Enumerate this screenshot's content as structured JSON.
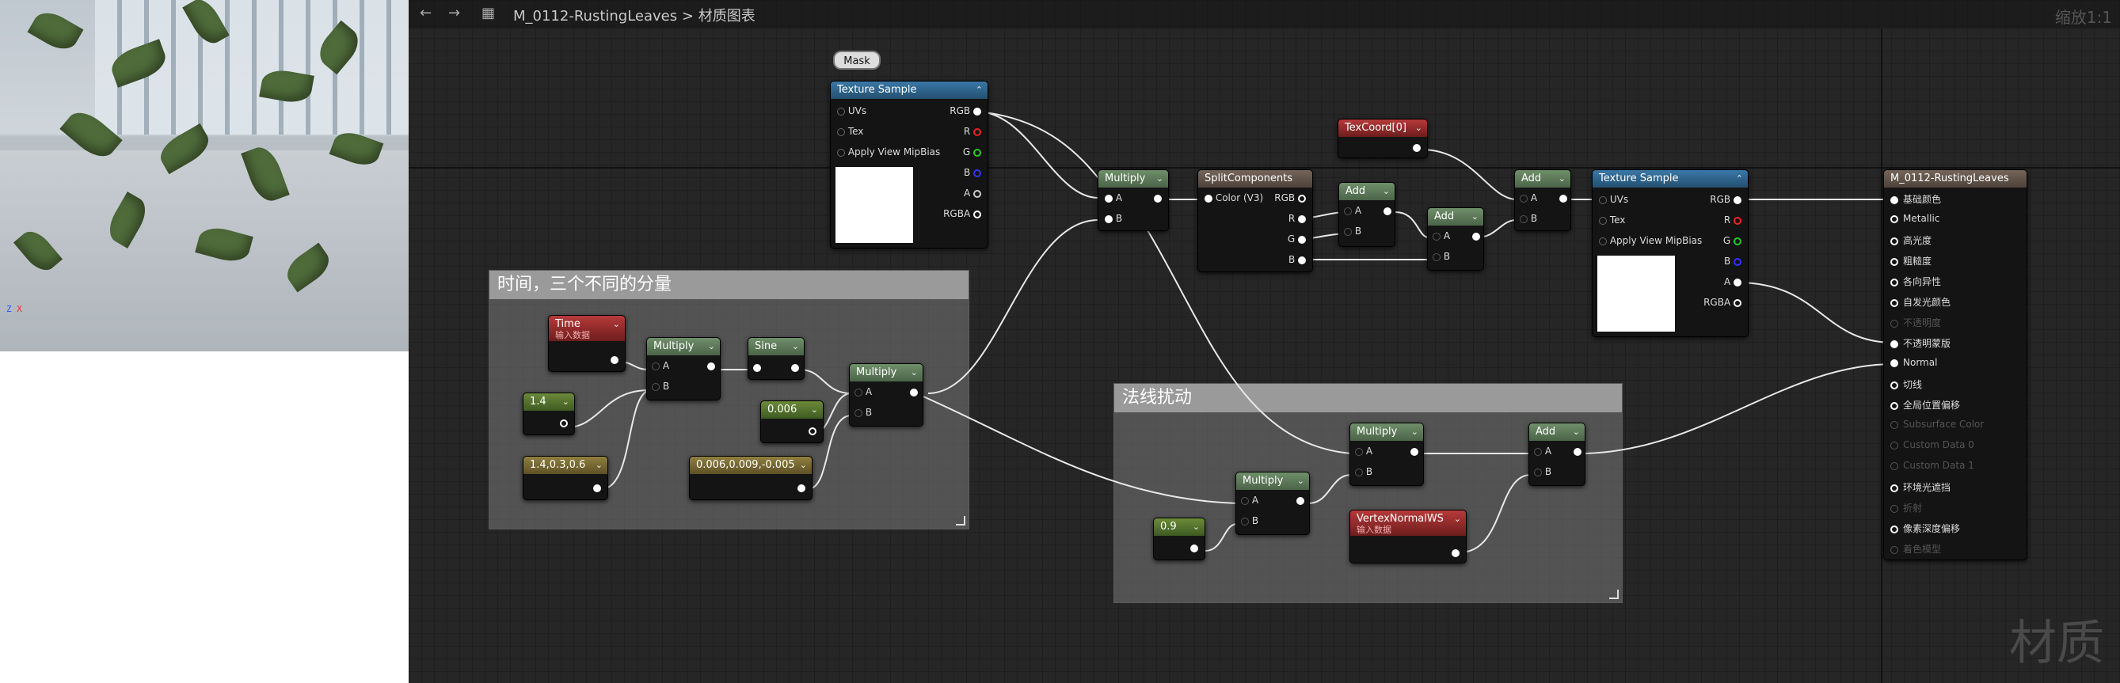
{
  "toolbar": {
    "back_icon": "arrow-left-icon",
    "forward_icon": "arrow-right-icon",
    "graph_icon": "graph-icon",
    "material_name": "M_0112-RustingLeaves",
    "separator": ">",
    "page": "材质图表",
    "zoom": "缩放1:1"
  },
  "preview": {
    "axis_z": "Z",
    "axis_x": "X"
  },
  "watermark": "材质",
  "comments": {
    "time": "时间，三个不同的分量",
    "normal": "法线扰动"
  },
  "nodes": {
    "mask": "Mask",
    "tex1": {
      "title": "Texture Sample",
      "pins_in": [
        "UVs",
        "Tex",
        "Apply View MipBias"
      ],
      "pins_out": [
        "RGB",
        "R",
        "G",
        "B",
        "A",
        "RGBA"
      ]
    },
    "multiply_top": {
      "title": "Multiply",
      "a": "A",
      "b": "B"
    },
    "split": {
      "title": "SplitComponents",
      "in": "Color (V3)",
      "rgb": "RGB",
      "r": "R",
      "g": "G",
      "b": "B"
    },
    "texcoord": {
      "title": "TexCoord[0]"
    },
    "add1": {
      "title": "Add",
      "a": "A",
      "b": "B"
    },
    "add2": {
      "title": "Add",
      "a": "A",
      "b": "B"
    },
    "add3": {
      "title": "Add",
      "a": "A",
      "b": "B"
    },
    "tex2": {
      "title": "Texture Sample",
      "pins_in": [
        "UVs",
        "Tex",
        "Apply View MipBias"
      ],
      "pins_out": [
        "RGB",
        "R",
        "G",
        "B",
        "A",
        "RGBA"
      ]
    },
    "time": {
      "title": "Time",
      "sub": "输入数据"
    },
    "const14": {
      "title": "1.4"
    },
    "const3": {
      "title": "1.4,0.3,0.6"
    },
    "multiply_t": {
      "title": "Multiply",
      "a": "A",
      "b": "B"
    },
    "sine": {
      "title": "Sine"
    },
    "const006": {
      "title": "0.006"
    },
    "const_vec": {
      "title": "0.006,0.009,-0.005"
    },
    "multiply_t2": {
      "title": "Multiply",
      "a": "A",
      "b": "B"
    },
    "const09": {
      "title": "0.9"
    },
    "multiply_n1": {
      "title": "Multiply",
      "a": "A",
      "b": "B"
    },
    "multiply_n2": {
      "title": "Multiply",
      "a": "A",
      "b": "B"
    },
    "vnormal": {
      "title": "VertexNormalWS",
      "sub": "输入数据"
    },
    "add_n": {
      "title": "Add",
      "a": "A",
      "b": "B"
    },
    "result": {
      "title": "M_0112-RustingLeaves",
      "pins": [
        "基础颜色",
        "Metallic",
        "高光度",
        "粗糙度",
        "各向异性",
        "自发光颜色",
        "不透明度",
        "不透明蒙版",
        "Normal",
        "切线",
        "全局位置偏移",
        "Subsurface Color",
        "Custom Data 0",
        "Custom Data 1",
        "环境光遮挡",
        "折射",
        "像素深度偏移",
        "着色模型"
      ],
      "enabled": [
        true,
        true,
        true,
        true,
        true,
        true,
        false,
        true,
        true,
        true,
        true,
        false,
        false,
        false,
        true,
        false,
        true,
        false
      ]
    }
  },
  "colors": {
    "graph_bg": "#262626",
    "green_header": "#5a7a55",
    "blue_header": "#2f6590",
    "red_header": "#9a2c2c",
    "wire": "#ffffff"
  }
}
